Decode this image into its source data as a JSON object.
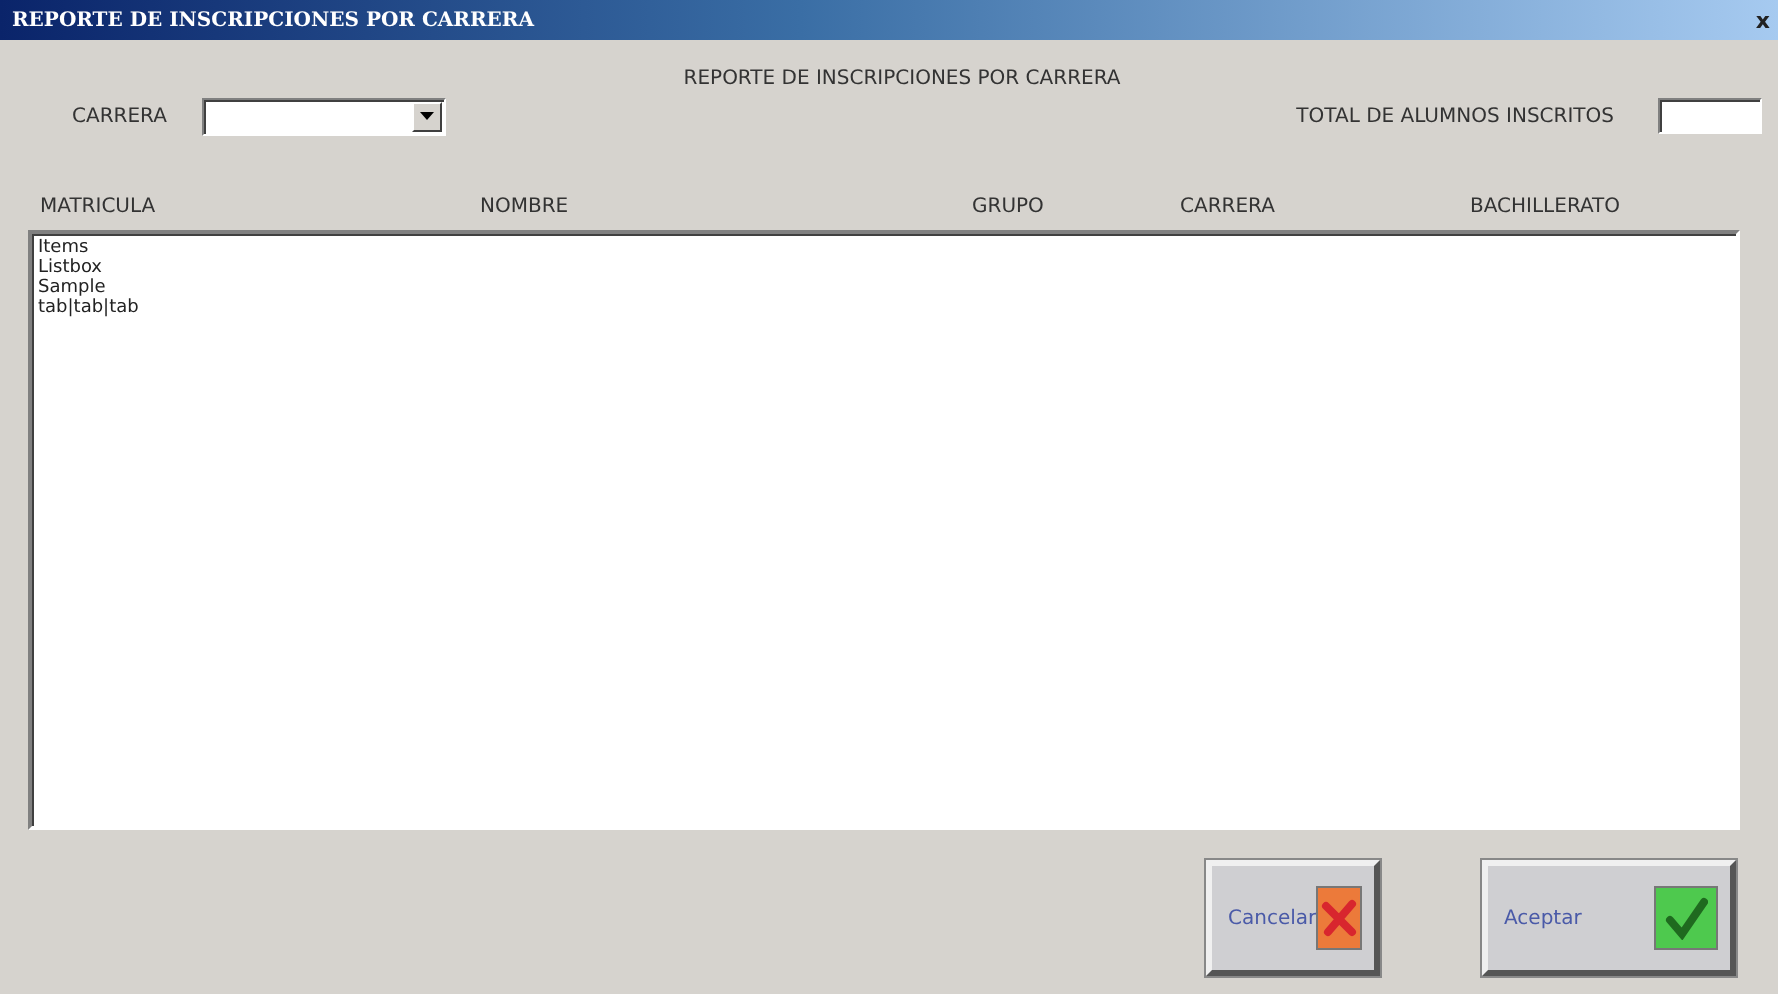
{
  "window": {
    "title": "REPORTE DE INSCRIPCIONES POR CARRERA",
    "close": "x"
  },
  "heading": "REPORTE DE INSCRIPCIONES POR CARRERA",
  "carrera_field": {
    "label": "CARRERA"
  },
  "total_field": {
    "label": "TOTAL DE ALUMNOS INSCRITOS"
  },
  "columns": [
    "MATRICULA",
    "NOMBRE",
    "GRUPO",
    "CARRERA",
    "BACHILLERATO"
  ],
  "list_items": [
    "Items",
    "Listbox",
    "Sample",
    "tab|tab|tab"
  ],
  "buttons": [
    {
      "label": "Cancelar",
      "kind": "cancel"
    },
    {
      "label": "Aceptar",
      "kind": "accept"
    }
  ]
}
